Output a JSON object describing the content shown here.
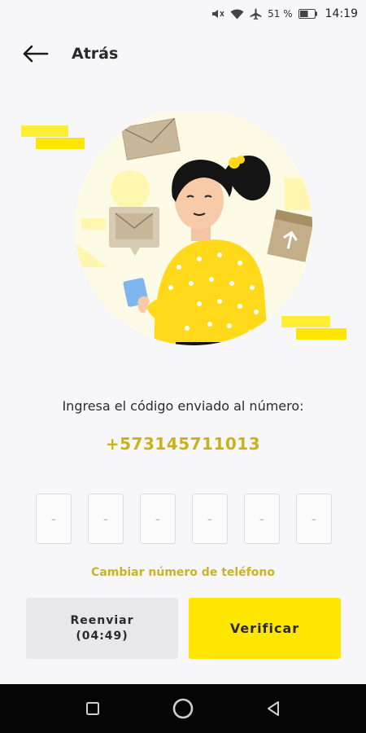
{
  "status_bar": {
    "icons": [
      "mute-icon",
      "wifi-icon",
      "airplane-icon",
      "battery-icon"
    ],
    "battery_percent": "51 %",
    "time": "14:19"
  },
  "header": {
    "back_icon": "arrow-left-icon",
    "title": "Atrás"
  },
  "illustration": {
    "subject": "woman-holding-phone-illustration",
    "accent_color": "#ffe600"
  },
  "verification": {
    "instruction": "Ingresa el código enviado al número:",
    "phone_number": "+573145711013",
    "code_placeholders": [
      "-",
      "-",
      "-",
      "-",
      "-",
      "-"
    ],
    "change_number_link": "Cambiar número de teléfono"
  },
  "buttons": {
    "resend_label": "Reenviar",
    "resend_timer": "(04:49)",
    "verify_label": "Verificar"
  },
  "nav_bar": {
    "icons": [
      "square-icon",
      "circle-icon",
      "triangle-back-icon"
    ]
  },
  "colors": {
    "accent": "#ffe600",
    "link": "#cbb326",
    "phone": "#c9b21c",
    "background": "#f7f7f9"
  }
}
